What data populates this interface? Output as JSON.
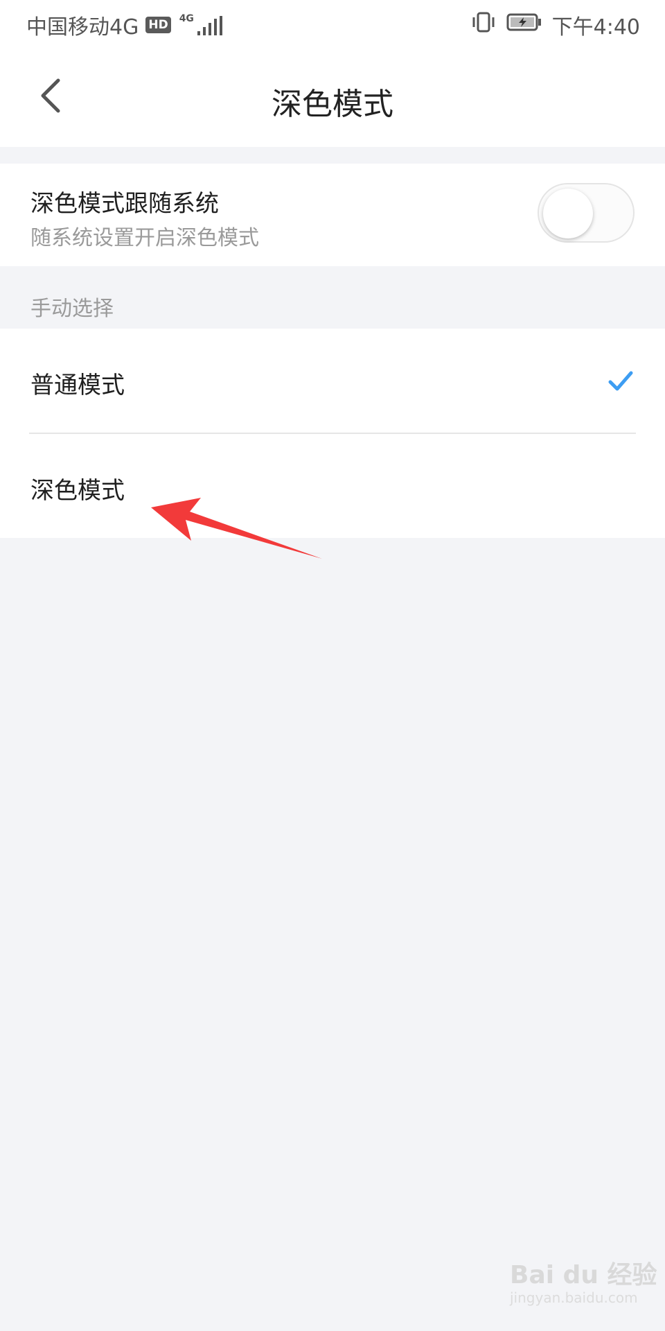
{
  "status_bar": {
    "carrier": "中国移动4G",
    "hd_badge": "HD",
    "network": "4G",
    "time": "下午4:40"
  },
  "nav": {
    "title": "深色模式"
  },
  "follow_system": {
    "title": "深色模式跟随系统",
    "subtitle": "随系统设置开启深色模式",
    "enabled": false
  },
  "manual": {
    "header": "手动选择",
    "options": [
      {
        "label": "普通模式",
        "selected": true
      },
      {
        "label": "深色模式",
        "selected": false
      }
    ]
  },
  "watermark": {
    "brand": "Bai du 经验",
    "url": "jingyan.baidu.com"
  },
  "colors": {
    "accent": "#3d9df2",
    "annotation_arrow": "#f23a3a",
    "background": "#f3f4f7"
  },
  "icons": [
    "signal-icon",
    "vibrate-icon",
    "battery-icon",
    "back-arrow-icon",
    "checkmark-icon",
    "annotation-arrow-icon"
  ]
}
